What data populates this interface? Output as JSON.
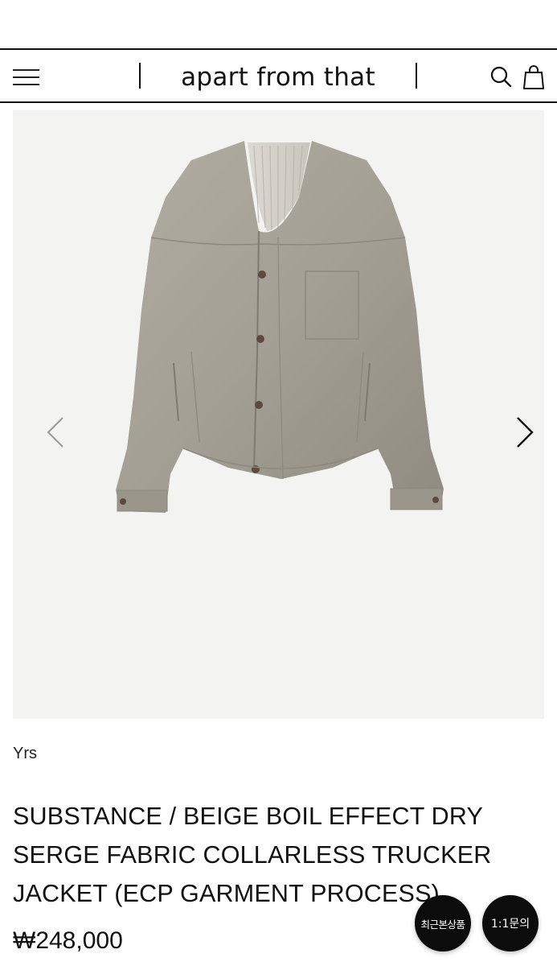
{
  "header": {
    "brand": "apart from that",
    "menu_icon": "hamburger-menu-icon",
    "search_icon": "search-icon",
    "cart_icon": "shopping-bag-icon"
  },
  "gallery": {
    "image_description_icon": "product-photo",
    "prev_icon": "chevron-left-icon",
    "next_icon": "chevron-right-icon"
  },
  "product": {
    "brand": "Yrs",
    "title": "SUBSTANCE / BEIGE BOIL EFFECT DRY SERGE FABRIC COLLARLESS TRUCKER JACKET (ECP GARMENT PROCESS)",
    "price": "₩248,000"
  },
  "floating": {
    "recent_label": "최근본상품",
    "inquiry_label": "1:1문의"
  },
  "colors": {
    "text": "#111111",
    "background": "#ffffff",
    "gallery_background": "#f3f3f2",
    "fab_background": "#0c0c0c",
    "jacket": "#a6a297"
  }
}
